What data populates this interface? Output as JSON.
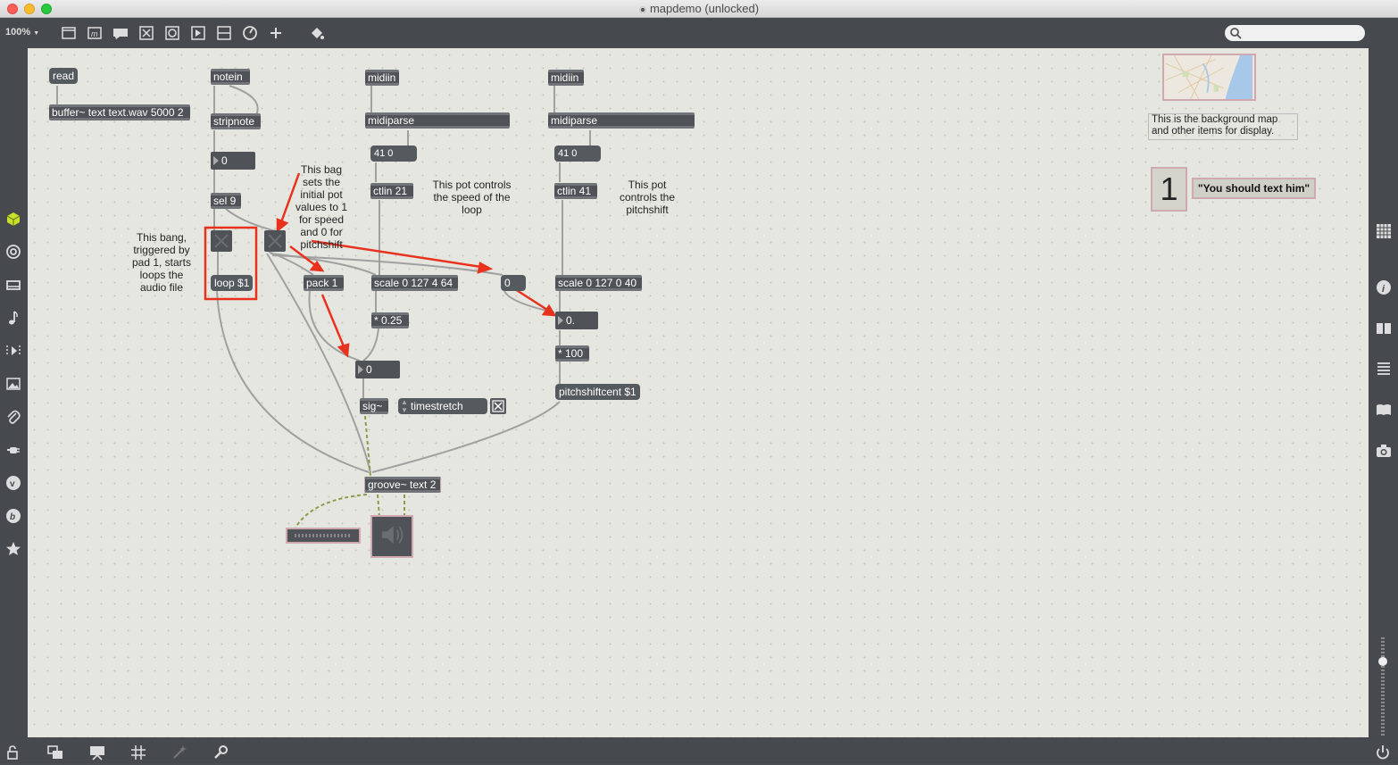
{
  "window": {
    "title": "mapdemo (unlocked)"
  },
  "toolbar": {
    "zoom": "100%",
    "zoom_arrow": "▼",
    "search_placeholder": ""
  },
  "patch": {
    "read_msg": "read",
    "buffer_obj": "buffer~ text text.wav 5000 2",
    "notein_obj": "notein",
    "stripnote_obj": "stripnote",
    "num_pitch": "0",
    "sel_obj": "sel 9",
    "loop_msg": "loop $1",
    "pack_obj": "pack 1",
    "midiin_1": "midiin",
    "midiparse_1": "midiparse",
    "msg_41_0_1": "41 0",
    "ctlin_21": "ctlin 21",
    "scale_speed": "scale 0 127 4 64",
    "mul_025": "* 0.25",
    "num_speed": "0",
    "sig_obj": "sig~",
    "timestretch_attr": "timestretch",
    "midiin_2": "midiin",
    "midiparse_2": "midiparse",
    "msg_41_0_2": "41 0",
    "ctlin_41": "ctlin 41",
    "msg_zero": "0",
    "scale_pitch": "scale 0 127 0 40",
    "num_pitch_float": "0.",
    "mul_100": "* 100",
    "pitchshift_msg": "pitchshiftcent $1",
    "groove_obj": "groove~ text 2",
    "comment_bag": "This bag sets the initial pot values to 1 for speed and 0 for pitchshift",
    "comment_bang": "This bang, triggered by pad 1, starts loops the audio file",
    "comment_speed": "This pot controls the speed of the loop",
    "comment_pitch": "This pot controls the pitchshift",
    "comment_map": "This is the background map and other items for display.",
    "big_number": "1",
    "quote_msg": "\"You should text him\""
  },
  "colors": {
    "canvas": "#e6e6e0",
    "object_bg": "#4f5357",
    "annotation_red": "#e8321e",
    "wire": "#a0a0a0",
    "signal_wire": "#9aa75a"
  },
  "icons": {
    "toolbar": [
      "presentation-icon",
      "comment-icon",
      "message-icon",
      "toggle-icon",
      "button-icon",
      "number-icon",
      "slider-icon",
      "dial-icon",
      "plus-icon",
      "paint-bucket-icon"
    ],
    "left_sidebar": [
      "cube-icon",
      "circle-icon",
      "device-icon",
      "note-icon",
      "sequence-icon",
      "image-icon",
      "paperclip-icon",
      "plug-icon",
      "vimeo-icon",
      "beta-icon",
      "star-icon"
    ],
    "right_sidebar": [
      "grid-icon",
      "info-icon",
      "book-icon",
      "list-icon",
      "reference-icon",
      "camera-icon"
    ],
    "bottom": [
      "lock-icon",
      "windows-icon",
      "presentation-mode-icon",
      "grid-snap-icon",
      "magic-icon",
      "wrench-icon",
      "power-icon"
    ]
  }
}
